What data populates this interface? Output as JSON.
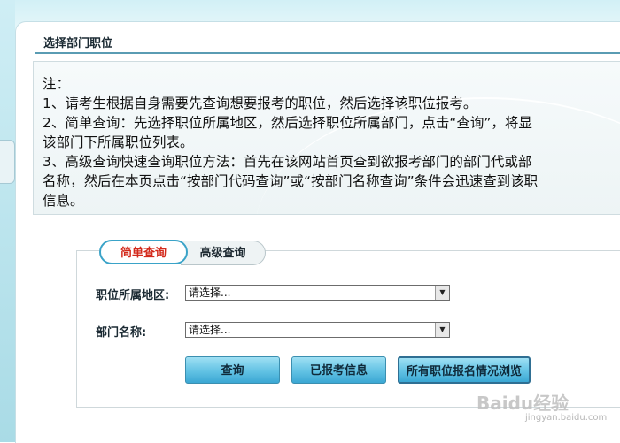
{
  "section": {
    "title": "选择部门职位"
  },
  "notes": {
    "lines": [
      "注：",
      "1、请考生根据自身需要先查询想要报考的职位，然后选择该职位报考。",
      "2、简单查询：先选择职位所属地区，然后选择职位所属部门，点击“查询”，将显",
      "该部门下所属职位列表。",
      "3、高级查询快速查询职位方法：首先在该网站首页查到欲报考部门的部门代或部",
      "名称，然后在本页点击“按部门代码查询”或“按部门名称查询”条件会迅速查到该职",
      "信息。"
    ]
  },
  "tabs": {
    "simple": "简单查询",
    "advanced": "高级查询"
  },
  "form": {
    "region_label": "职位所属地区:",
    "region_value": "请选择...",
    "department_label": "部门名称:",
    "department_value": "请选择..."
  },
  "buttons": {
    "query": "查询",
    "reported": "已报考信息",
    "browse_all": "所有职位报名情况浏览"
  },
  "watermark": {
    "main": "Baidu经验",
    "sub": "jingyan.baidu.com"
  },
  "colors": {
    "accent": "#3aa7d3",
    "active_tab_text": "#d32a1c",
    "rule": "#5a9cb3"
  }
}
